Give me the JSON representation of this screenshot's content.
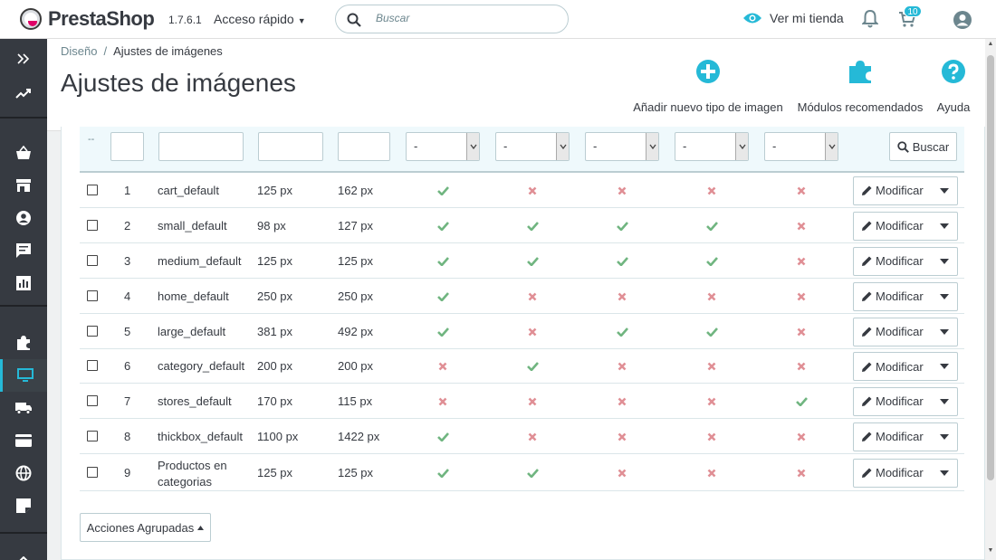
{
  "header": {
    "brand": "PrestaShop",
    "version": "1.7.6.1",
    "quick_access": "Acceso rápido",
    "search_placeholder": "Buscar",
    "view_store": "Ver mi tienda",
    "cart_badge": "10"
  },
  "breadcrumb": {
    "parent": "Diseño",
    "separator": "/",
    "current": "Ajustes de imágenes"
  },
  "page_title": "Ajustes de imágenes",
  "toolbar": {
    "add": "Añadir nuevo tipo de imagen",
    "modules": "Módulos recomendados",
    "help": "Ayuda"
  },
  "filters": {
    "dash": "--",
    "select_value": "-",
    "search_button": "Buscar"
  },
  "rows": [
    {
      "id": "1",
      "name": "cart_default",
      "width": "125 px",
      "height": "162 px",
      "flags": [
        true,
        false,
        false,
        false,
        false
      ]
    },
    {
      "id": "2",
      "name": "small_default",
      "width": "98 px",
      "height": "127 px",
      "flags": [
        true,
        true,
        true,
        true,
        false
      ]
    },
    {
      "id": "3",
      "name": "medium_default",
      "width": "125 px",
      "height": "125 px",
      "flags": [
        true,
        true,
        true,
        true,
        false
      ]
    },
    {
      "id": "4",
      "name": "home_default",
      "width": "250 px",
      "height": "250 px",
      "flags": [
        true,
        false,
        false,
        false,
        false
      ]
    },
    {
      "id": "5",
      "name": "large_default",
      "width": "381 px",
      "height": "492 px",
      "flags": [
        true,
        false,
        true,
        true,
        false
      ]
    },
    {
      "id": "6",
      "name": "category_default",
      "width": "200 px",
      "height": "200 px",
      "flags": [
        false,
        true,
        false,
        false,
        false
      ]
    },
    {
      "id": "7",
      "name": "stores_default",
      "width": "170 px",
      "height": "115 px",
      "flags": [
        false,
        false,
        false,
        false,
        true
      ]
    },
    {
      "id": "8",
      "name": "thickbox_default",
      "width": "1100 px",
      "height": "1422 px",
      "flags": [
        true,
        false,
        false,
        false,
        false
      ]
    },
    {
      "id": "9",
      "name": "Productos en categorias",
      "name_lines": [
        "Productos en",
        "categorias"
      ],
      "width": "125 px",
      "height": "125 px",
      "flags": [
        true,
        true,
        false,
        false,
        false
      ]
    }
  ],
  "row_action": "Modificar",
  "bulk_actions": "Acciones Agrupadas",
  "colors": {
    "accent": "#25b9d7",
    "ok": "#70b580",
    "no": "#e08f95",
    "sidebar": "#363a41"
  }
}
